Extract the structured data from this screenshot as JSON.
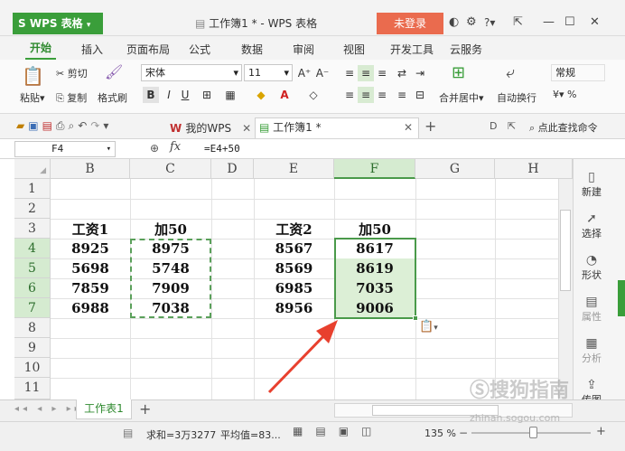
{
  "app": {
    "name": "WPS 表格",
    "window_title": "工作簿1 * - WPS 表格",
    "login_label": "未登录",
    "help_label": "?"
  },
  "ribbon_tabs": [
    "开始",
    "插入",
    "页面布局",
    "公式",
    "数据",
    "审阅",
    "视图",
    "开发工具",
    "云服务"
  ],
  "ribbon": {
    "cut": "剪切",
    "paste": "粘贴",
    "copy": "复制",
    "format_painter": "格式刷",
    "font_name": "宋体",
    "font_size": "11",
    "merge_center": "合并居中",
    "wrap_text": "自动换行",
    "number_format": "常规",
    "percent": "%"
  },
  "quickbar": {
    "doc_tab_1": "我的WPS",
    "doc_tab_2": "工作簿1 *",
    "search": "点此查找命令"
  },
  "formula_bar": {
    "name_box": "F4",
    "fx": "fx",
    "formula": "=E4+50"
  },
  "columns": [
    "B",
    "C",
    "D",
    "E",
    "F",
    "G",
    "H"
  ],
  "rows": [
    "1",
    "2",
    "3",
    "4",
    "5",
    "6",
    "7",
    "8",
    "9",
    "10",
    "11"
  ],
  "table1": {
    "header_b": "工资1",
    "header_c": "加50",
    "b": [
      "8925",
      "5698",
      "7859",
      "6988"
    ],
    "c": [
      "8975",
      "5748",
      "7909",
      "7038"
    ]
  },
  "table2": {
    "header_e": "工资2",
    "header_f": "加50",
    "e": [
      "8567",
      "8569",
      "6985",
      "8956"
    ],
    "f": [
      "8617",
      "8619",
      "7035",
      "9006"
    ]
  },
  "right_panel": [
    "新建",
    "选择",
    "形状",
    "属性",
    "分析",
    "传图"
  ],
  "sheet_tab": "工作表1",
  "status": {
    "sum": "求和=3万3277",
    "avg": "平均值=83...",
    "zoom": "135 %"
  },
  "watermark": {
    "text": "搜狗指南",
    "url": "zhinan.sogou.com"
  },
  "colors": {
    "accent": "#3a9e3a",
    "login": "#ea6b4e",
    "arrow": "#e8402e",
    "selection": "#4a9a4a"
  }
}
